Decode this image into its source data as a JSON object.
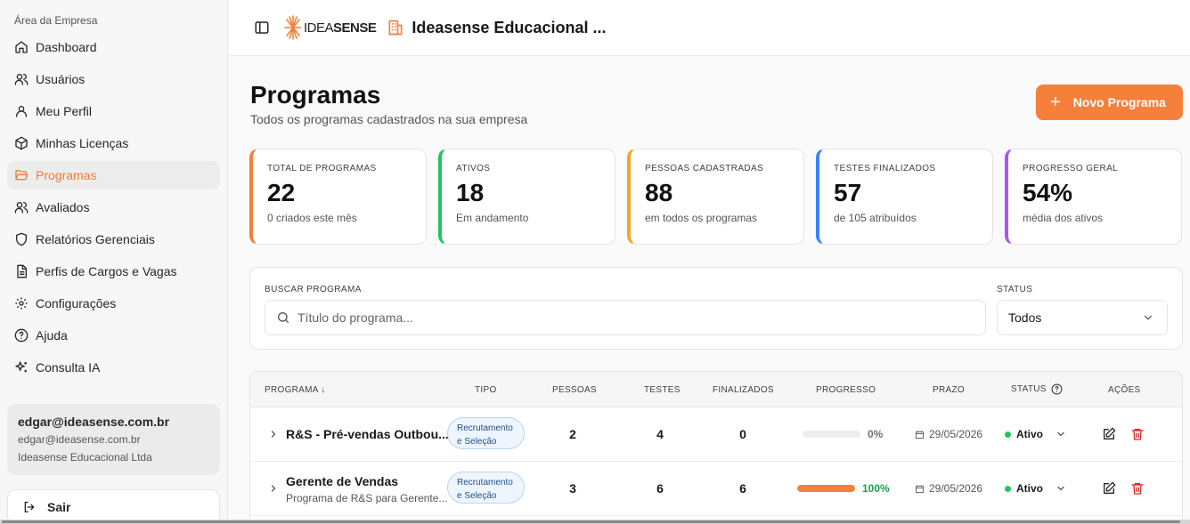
{
  "sidebar": {
    "section_label": "Área da Empresa",
    "items": [
      {
        "label": "Dashboard",
        "icon": "home-icon"
      },
      {
        "label": "Usuários",
        "icon": "users-icon"
      },
      {
        "label": "Meu Perfil",
        "icon": "user-icon"
      },
      {
        "label": "Minhas Licenças",
        "icon": "package-icon"
      },
      {
        "label": "Programas",
        "icon": "folder-open-icon",
        "active": true
      },
      {
        "label": "Avaliados",
        "icon": "users-icon"
      },
      {
        "label": "Relatórios Gerenciais",
        "icon": "shield-icon"
      },
      {
        "label": "Perfis de Cargos e Vagas",
        "icon": "file-icon"
      },
      {
        "label": "Configurações",
        "icon": "gear-icon"
      },
      {
        "label": "Ajuda",
        "icon": "help-circle-icon"
      },
      {
        "label": "Consulta IA",
        "icon": "sparkles-icon"
      }
    ],
    "user": {
      "name": "edgar@ideasense.com.br",
      "email": "edgar@ideasense.com.br",
      "company": "Ideasense Educacional Ltda"
    },
    "logout_label": "Sair"
  },
  "header": {
    "logo_text_light": "IDEA",
    "logo_text_bold": "SENSE",
    "company_name": "Ideasense Educacional ..."
  },
  "page": {
    "title": "Programas",
    "subtitle": "Todos os programas cadastrados na sua empresa",
    "new_button_label": "Novo Programa"
  },
  "stats": [
    {
      "label": "TOTAL DE PROGRAMAS",
      "value": "22",
      "caption": "0 criados este mês",
      "color": "#f5803b"
    },
    {
      "label": "ATIVOS",
      "value": "18",
      "caption": "Em andamento",
      "color": "#22c55e"
    },
    {
      "label": "PESSOAS CADASTRADAS",
      "value": "88",
      "caption": "em todos os programas",
      "color": "#f5a524"
    },
    {
      "label": "TESTES FINALIZADOS",
      "value": "57",
      "caption": "de 105 atribuídos",
      "color": "#3b82f6"
    },
    {
      "label": "PROGRESSO GERAL",
      "value": "54%",
      "caption": "média dos ativos",
      "color": "#a855f7"
    }
  ],
  "filters": {
    "search_label": "BUSCAR PROGRAMA",
    "search_placeholder": "Título do programa...",
    "status_label": "STATUS",
    "status_value": "Todos"
  },
  "table": {
    "headers": {
      "programa": "PROGRAMA ↓",
      "tipo": "TIPO",
      "pessoas": "PESSOAS",
      "testes": "TESTES",
      "finalizados": "FINALIZADOS",
      "progresso": "PROGRESSO",
      "prazo": "PRAZO",
      "status": "STATUS",
      "acoes": "AÇÕES"
    },
    "rows": [
      {
        "name": "R&S - Pré-vendas Outbou...",
        "desc": "",
        "tipo_line1": "Recrutamento",
        "tipo_line2": "e Seleção",
        "pessoas": "2",
        "testes": "4",
        "finalizados": "0",
        "progress": 0,
        "progress_label": "0%",
        "progress_color": "#71717a",
        "prazo": "29/05/2026",
        "status": "Ativo"
      },
      {
        "name": "Gerente de Vendas",
        "desc": "Programa de R&S para Gerente...",
        "tipo_line1": "Recrutamento",
        "tipo_line2": "e Seleção",
        "pessoas": "3",
        "testes": "6",
        "finalizados": "6",
        "progress": 100,
        "progress_label": "100%",
        "progress_color": "#16a34a",
        "prazo": "29/05/2026",
        "status": "Ativo"
      }
    ]
  }
}
